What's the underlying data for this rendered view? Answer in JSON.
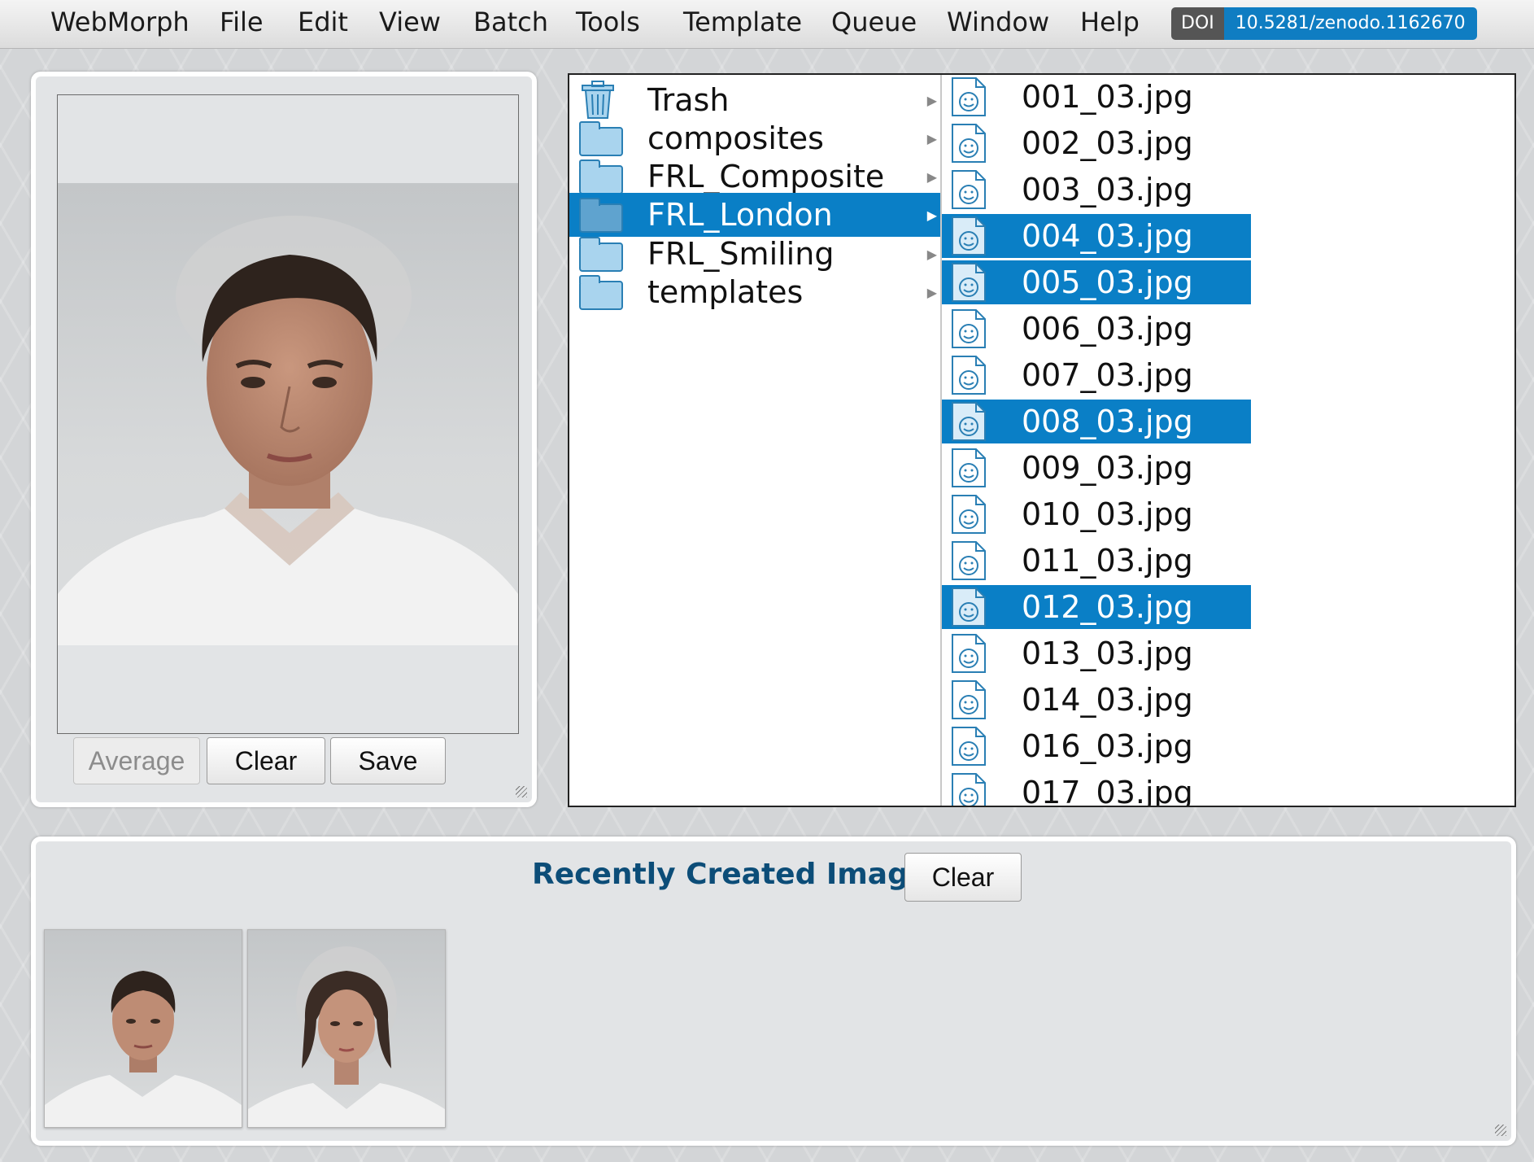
{
  "menubar": {
    "app_name": "WebMorph",
    "items": [
      "File",
      "Edit",
      "View",
      "Batch",
      "Tools",
      "Template",
      "Queue",
      "Window",
      "Help"
    ],
    "doi_label": "DOI",
    "doi_value": "10.5281/zenodo.1162670"
  },
  "average_panel": {
    "average_button": "Average",
    "clear_button": "Clear",
    "save_button": "Save"
  },
  "finder": {
    "directories": [
      {
        "name": "Trash",
        "icon": "trash-icon",
        "selected": false
      },
      {
        "name": "composites",
        "icon": "folder-icon",
        "selected": false
      },
      {
        "name": "FRL_Composite",
        "icon": "folder-icon",
        "selected": false
      },
      {
        "name": "FRL_London",
        "icon": "folder-icon",
        "selected": true
      },
      {
        "name": "FRL_Smiling",
        "icon": "folder-icon",
        "selected": false
      },
      {
        "name": "templates",
        "icon": "folder-icon",
        "selected": false
      }
    ],
    "files": [
      {
        "name": "001_03.jpg",
        "selected": false
      },
      {
        "name": "002_03.jpg",
        "selected": false
      },
      {
        "name": "003_03.jpg",
        "selected": false
      },
      {
        "name": "004_03.jpg",
        "selected": true
      },
      {
        "name": "005_03.jpg",
        "selected": true
      },
      {
        "name": "006_03.jpg",
        "selected": false
      },
      {
        "name": "007_03.jpg",
        "selected": false
      },
      {
        "name": "008_03.jpg",
        "selected": true
      },
      {
        "name": "009_03.jpg",
        "selected": false
      },
      {
        "name": "010_03.jpg",
        "selected": false
      },
      {
        "name": "011_03.jpg",
        "selected": false
      },
      {
        "name": "012_03.jpg",
        "selected": true
      },
      {
        "name": "013_03.jpg",
        "selected": false
      },
      {
        "name": "014_03.jpg",
        "selected": false
      },
      {
        "name": "016_03.jpg",
        "selected": false
      },
      {
        "name": "017_03.jpg",
        "selected": false
      }
    ]
  },
  "recent": {
    "title": "Recently Created Images",
    "clear_button": "Clear"
  },
  "colors": {
    "selection": "#0a7fc6",
    "title_blue": "#0c4d78",
    "doi_blue": "#0f7dc2"
  }
}
